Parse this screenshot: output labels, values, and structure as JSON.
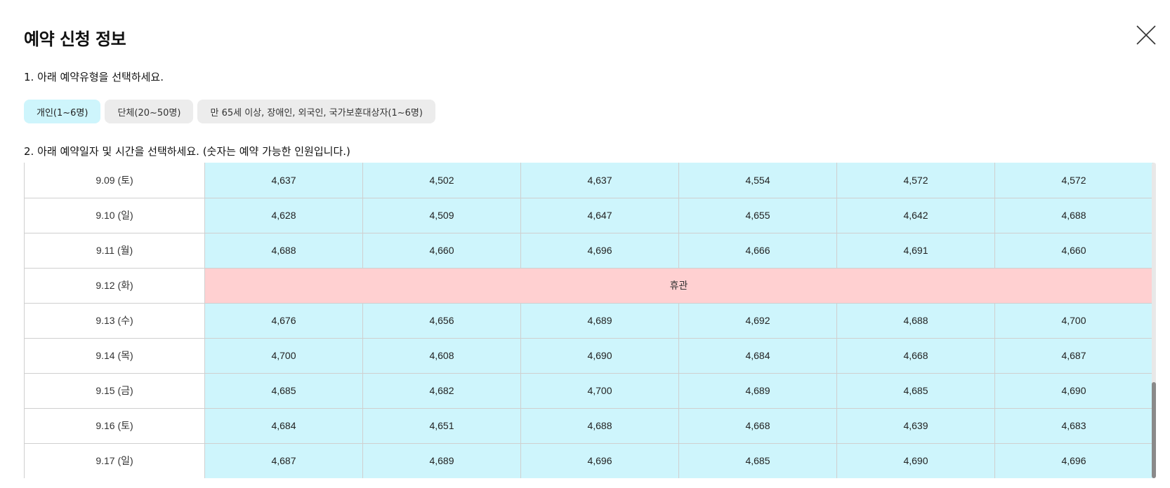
{
  "modal": {
    "title": "예약 신청 정보",
    "close_icon": "close-icon"
  },
  "step1": {
    "label": "1. 아래 예약유형을 선택하세요."
  },
  "types": [
    {
      "label": "개인(1~6명)",
      "selected": true
    },
    {
      "label": "단체(20~50명)",
      "selected": false
    },
    {
      "label": "만 65세 이상, 장애인, 외국인, 국가보훈대상자(1~6명)",
      "selected": false
    }
  ],
  "step2": {
    "label": "2. 아래 예약일자 및 시간을 선택하세요. (숫자는 예약 가능한 인원입니다.)"
  },
  "schedule": {
    "rows": [
      {
        "date": "9.09 (토)",
        "slots": [
          "4,637",
          "4,502",
          "4,637",
          "4,554",
          "4,572",
          "4,572"
        ]
      },
      {
        "date": "9.10 (일)",
        "slots": [
          "4,628",
          "4,509",
          "4,647",
          "4,655",
          "4,642",
          "4,688"
        ]
      },
      {
        "date": "9.11 (월)",
        "slots": [
          "4,688",
          "4,660",
          "4,696",
          "4,666",
          "4,691",
          "4,660"
        ]
      },
      {
        "date": "9.12 (화)",
        "closed": "휴관"
      },
      {
        "date": "9.13 (수)",
        "slots": [
          "4,676",
          "4,656",
          "4,689",
          "4,692",
          "4,688",
          "4,700"
        ]
      },
      {
        "date": "9.14 (목)",
        "slots": [
          "4,700",
          "4,608",
          "4,690",
          "4,684",
          "4,668",
          "4,687"
        ]
      },
      {
        "date": "9.15 (금)",
        "slots": [
          "4,685",
          "4,682",
          "4,700",
          "4,689",
          "4,685",
          "4,690"
        ]
      },
      {
        "date": "9.16 (토)",
        "slots": [
          "4,684",
          "4,651",
          "4,688",
          "4,668",
          "4,639",
          "4,683"
        ]
      },
      {
        "date": "9.17 (일)",
        "slots": [
          "4,687",
          "4,689",
          "4,696",
          "4,685",
          "4,690",
          "4,696"
        ]
      }
    ]
  },
  "colors": {
    "available": "#cef5fc",
    "closed": "#ffd0d1",
    "selected_tab": "#cef5fc",
    "tab": "#ececec"
  }
}
